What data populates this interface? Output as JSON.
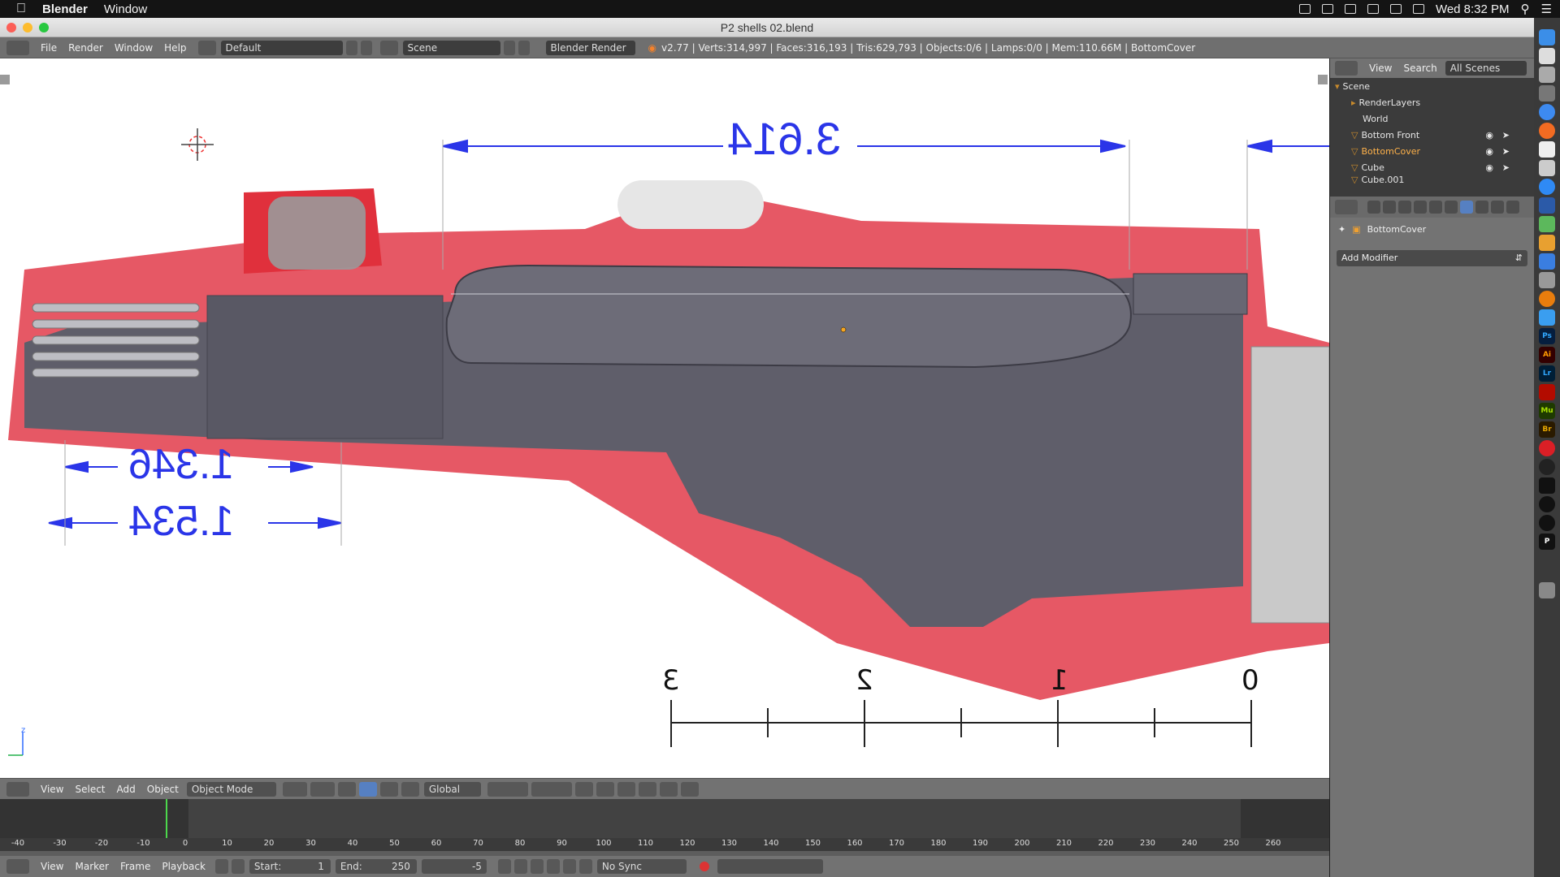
{
  "mac_menubar": {
    "app_name": "Blender",
    "menu_window": "Window",
    "clock": "Wed 8:32 PM"
  },
  "window": {
    "title": "P2 shells 02.blend"
  },
  "blender_header": {
    "menus": [
      "File",
      "Render",
      "Window",
      "Help"
    ],
    "layout": "Default",
    "scene": "Scene",
    "engine": "Blender Render",
    "stats": "v2.77 | Verts:314,997 | Faces:316,193 | Tris:629,793 | Objects:0/6 | Lamps:0/0 | Mem:110.66M | BottomCover"
  },
  "viewport": {
    "dimension_top": "3.614",
    "dimension_a": "1.346",
    "dimension_b": "1.534",
    "scale_labels": [
      "3",
      "2",
      "1",
      "0"
    ],
    "axis_label": "z"
  },
  "viewport_header": {
    "menus": [
      "View",
      "Select",
      "Add",
      "Object"
    ],
    "mode": "Object Mode",
    "orientation": "Global"
  },
  "timeline": {
    "ruler_labels": [
      "-40",
      "-30",
      "-20",
      "-10",
      "0",
      "10",
      "20",
      "30",
      "40",
      "50",
      "60",
      "70",
      "80",
      "90",
      "100",
      "110",
      "120",
      "130",
      "140",
      "150",
      "160",
      "170",
      "180",
      "190",
      "200",
      "210",
      "220",
      "230",
      "240",
      "250",
      "260"
    ],
    "current_frame_marker": 1
  },
  "timeline_header": {
    "menus": [
      "View",
      "Marker",
      "Frame",
      "Playback"
    ],
    "start_label": "Start:",
    "start_value": "1",
    "end_label": "End:",
    "end_value": "250",
    "current": "-5",
    "sync": "No Sync"
  },
  "outliner": {
    "menu_view": "View",
    "menu_search": "Search",
    "filter": "All Scenes",
    "items": [
      {
        "label": "Scene",
        "indent": 0
      },
      {
        "label": "RenderLayers",
        "indent": 1
      },
      {
        "label": "World",
        "indent": 1
      },
      {
        "label": "Bottom Front",
        "indent": 1
      },
      {
        "label": "BottomCover",
        "indent": 1
      },
      {
        "label": "Cube",
        "indent": 1
      },
      {
        "label": "Cube.001",
        "indent": 1
      }
    ]
  },
  "properties": {
    "object_name": "BottomCover",
    "add_modifier": "Add Modifier"
  },
  "dock_icons": [
    "finder-icon",
    "safari-icon",
    "mail-icon",
    "photos-icon",
    "chrome-icon",
    "firefox-icon",
    "notes-icon",
    "calendar-icon",
    "messages-icon",
    "word-icon",
    "maps-icon",
    "numbers-icon",
    "keynote-icon",
    "preview-icon",
    "blender-icon",
    "appstore-icon",
    "photoshop-icon",
    "illustrator-icon",
    "lightroom-icon",
    "acrobat-icon",
    "muse-icon",
    "bridge-icon",
    "cc-icon",
    "steam-icon",
    "epic-icon",
    "unity-icon",
    "ue-icon",
    "p-icon",
    "trash-icon"
  ],
  "dock_labels": {
    "ps": "Ps",
    "ai": "Ai",
    "lr": "Lr",
    "mu": "Mu",
    "br": "Br",
    "p": "P"
  }
}
